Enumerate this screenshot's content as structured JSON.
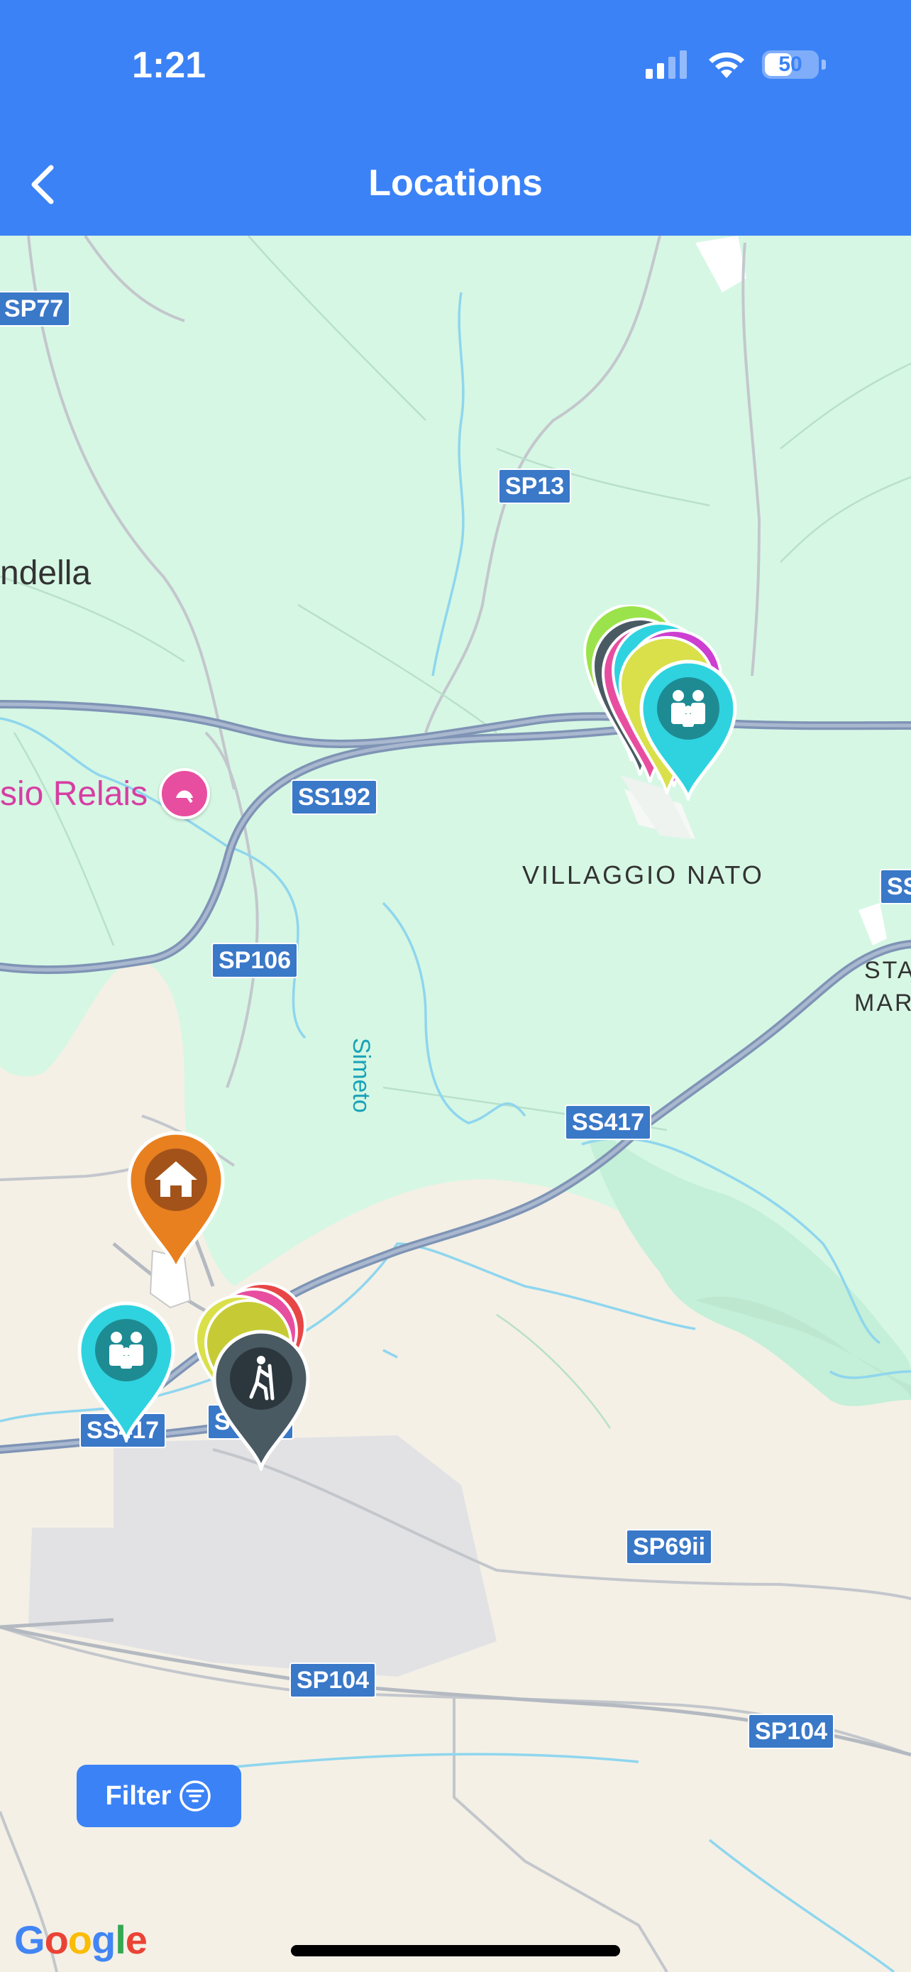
{
  "status_bar": {
    "time": "1:21",
    "battery": "50"
  },
  "nav": {
    "title": "Locations"
  },
  "map": {
    "road_labels": [
      "SP77",
      "SP13",
      "SS192",
      "SP106",
      "SS417",
      "SS417",
      "SS417",
      "SP69ii",
      "SP104",
      "SP104",
      "SS"
    ],
    "place_labels": [
      "ndella",
      "sio Relais",
      "VILLAGGIO NATO",
      "STA",
      "MAR",
      "Simeto"
    ],
    "markers": [
      {
        "type": "family",
        "color": "#2ed3df"
      },
      {
        "type": "home",
        "color": "#e8801f"
      },
      {
        "type": "family",
        "color": "#2ed3df"
      },
      {
        "type": "hiking",
        "color": "#4a5a63"
      }
    ],
    "attribution": "Google"
  },
  "filter": {
    "label": "Filter"
  },
  "colors": {
    "accent": "#3b82f6",
    "road_shield": "#3a78c8",
    "green_area": "#d6f7e4",
    "map_land": "#f4f0e6"
  }
}
